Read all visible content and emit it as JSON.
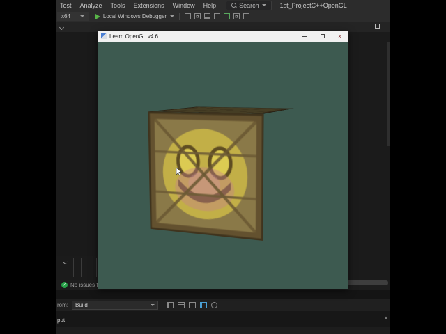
{
  "menubar": {
    "items": [
      "Test",
      "Analyze",
      "Tools",
      "Extensions",
      "Window",
      "Help"
    ],
    "search_label": "Search",
    "solution_name": "1st_ProjectC++OpenGL"
  },
  "toolbar": {
    "platform_selector": "x64",
    "run_button_label": "Local Windows Debugger"
  },
  "gl_window": {
    "title": "Learn OpenGL v4.6",
    "close_glyph": "×"
  },
  "status": {
    "issues_label": "No issues found",
    "check_glyph": "✓"
  },
  "output_panel": {
    "from_label_partial": "rom:",
    "source_value": "Build",
    "tab_label_partial": "put",
    "scroll_up_glyph": "▲"
  },
  "colors": {
    "viewport_background": "#3d5a50",
    "run_green": "#58b548",
    "check_green": "#27a148",
    "crate_yellow": "#d2bf46",
    "title_bar": "#f1f1f1",
    "ide_background": "#1e1e1e"
  }
}
